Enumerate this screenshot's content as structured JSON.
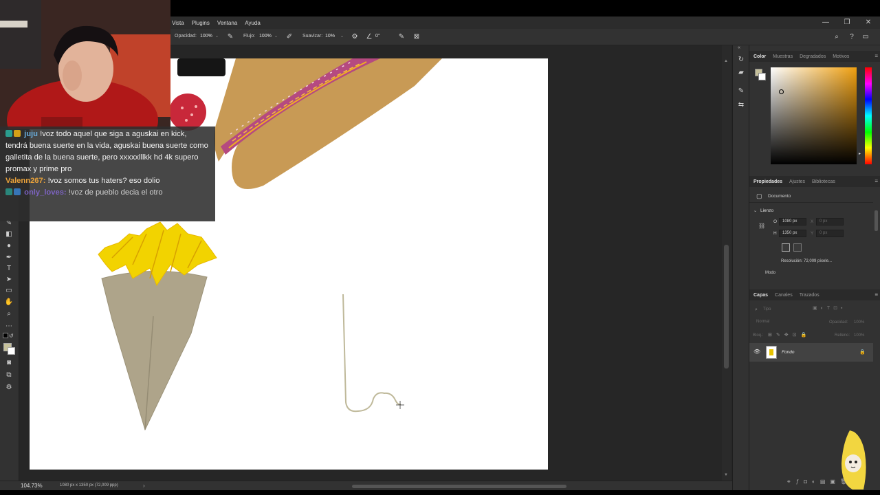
{
  "menu": [
    "Vista",
    "Plugins",
    "Ventana",
    "Ayuda"
  ],
  "options_bar": {
    "opacity_label": "Opacidad:",
    "opacity_value": "100%",
    "flow_label": "Flujo:",
    "flow_value": "100%",
    "smoothing_label": "Suavizar:",
    "smoothing_value": "10%",
    "angle_value": "0°"
  },
  "window_controls": {
    "minimize": "—",
    "restore": "❐",
    "close": "✕"
  },
  "status": {
    "zoom": "104.73%",
    "doc_info": "1080 px x 1350 px (72,009 ppp)"
  },
  "color_panel": {
    "tabs": [
      "Color",
      "Muestras",
      "Degradados",
      "Motivos"
    ],
    "foreground": "#c5c09a",
    "background": "#ffffff",
    "hue_color": "#f0a010"
  },
  "properties_panel": {
    "tabs": [
      "Propiedades",
      "Ajustes",
      "Bibliotecas"
    ],
    "doc_label": "Documento",
    "section": "Lienzo",
    "w_label": "O",
    "w_value": "1080 px",
    "h_label": "H",
    "h_value": "1350 px",
    "x_label": "X",
    "x_value": "0 px",
    "y_label": "Y",
    "y_value": "0 px",
    "resolution": "Resolución: 72,009 píxele...",
    "mode_label": "Modo"
  },
  "layers_panel": {
    "tabs": [
      "Capas",
      "Canales",
      "Trazados"
    ],
    "search_placeholder": "Tipo",
    "blend_mode": "Normal",
    "opacity_label": "Opacidad:",
    "opacity_value": "100%",
    "lock_label": "Bloq.:",
    "fill_label": "Relleno:",
    "fill_value": "100%",
    "layers": [
      {
        "name": "Fondo",
        "visible": true,
        "locked": true
      }
    ]
  },
  "chat": [
    {
      "user": "juju",
      "name_color": "#6ab0e0",
      "message": "!voz todo aquel que  siga a aguskai en kick,  tendrá buena suerte en la vida, aguskai buena suerte como galletita de la buena suerte, pero xxxxxlllkk hd 4k supero promax y prime pro"
    },
    {
      "user": "Valenn267:",
      "name_color": "#e8a13a",
      "message": "!voz somos tus haters? eso dolio"
    },
    {
      "user": "only_loves:",
      "name_color": "#8a6adf",
      "message": "!voz de pueblo decia el otro"
    }
  ],
  "icons": {
    "tools": [
      "move-icon",
      "marquee-icon",
      "lasso-icon",
      "crop-icon",
      "eyedropper-icon",
      "brush-icon",
      "stamp-icon",
      "eraser-icon",
      "gradient-icon",
      "dodge-icon",
      "pen-icon",
      "text-icon",
      "path-select-icon",
      "rectangle-icon",
      "hand-icon",
      "zoom-icon",
      "more-tools-icon"
    ]
  }
}
